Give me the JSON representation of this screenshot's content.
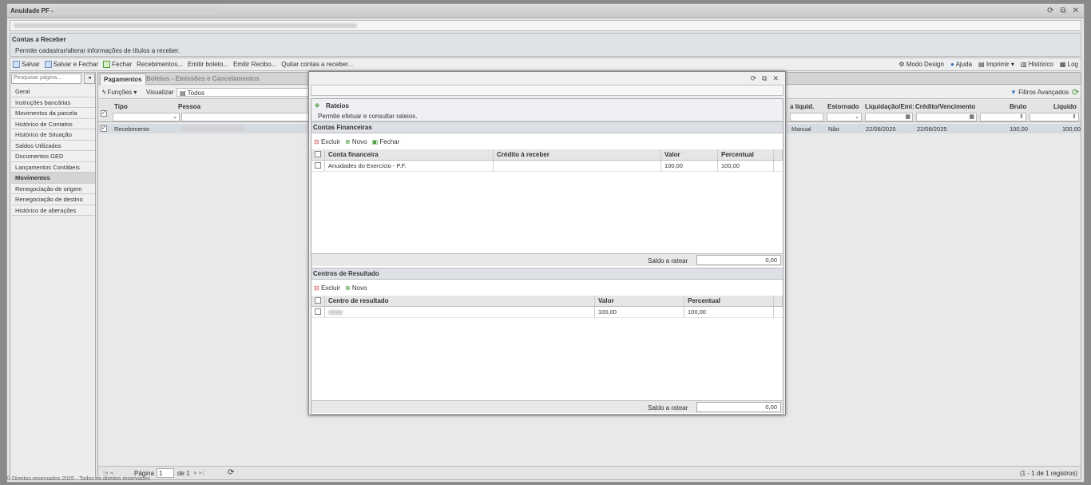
{
  "window": {
    "title": "Anuidade PF -"
  },
  "header": {
    "title": "Contas a Receber",
    "subtitle": "Permite cadastrar/alterar informações de títulos a receber."
  },
  "toolbar": {
    "salvar": "Salvar",
    "salvar_fechar": "Salvar e Fechar",
    "fechar": "Fechar",
    "recebimentos": "Recebimentos...",
    "emitir_boleto": "Emitir boleto...",
    "emitir_recibo": "Emitir Recibo...",
    "quitar": "Quitar contas a receber...",
    "modo_design": "Modo Design",
    "ajuda": "Ajuda",
    "imprimir": "Imprimir",
    "historico": "Histórico",
    "log": "Log"
  },
  "sidebar": {
    "search_placeholder": "Pesquisar página...",
    "items": [
      "Geral",
      "Instruções bancárias",
      "Movimentos da parcela",
      "Histórico de Contatos",
      "Histórico de Situação",
      "Saldos Utilizados",
      "Documentos GED",
      "Lançamentos Contábeis",
      "Movimentos",
      "Renegociação de origem",
      "Renegociação de destino",
      "Histórico de alterações"
    ],
    "selected": "Movimentos"
  },
  "tabs": {
    "pagamentos": "Pagamentos",
    "boletos": "Boletos - Emissões e Cancelamentos"
  },
  "grid_toolbar": {
    "funcoes": "Funções",
    "visualizar": "Visualizar",
    "todos": "Todos",
    "filtros": "Filtros Avançados"
  },
  "grid": {
    "columns": {
      "tipo": "Tipo",
      "pessoa": "Pessoa",
      "liquid": "a liquid.",
      "estornado": "Estornado",
      "liquidacao": "Liquidação/Emi:",
      "credito": "Crédito/Vencimento",
      "bruto": "Bruto",
      "liquido": "Líquido"
    },
    "row": {
      "tipo": "Recebimento",
      "liquid": "Manual",
      "estornado": "Não",
      "liquidacao": "22/08/2025",
      "credito": "22/08/2025",
      "bruto": "100,00",
      "liquido": "100,00"
    }
  },
  "pager": {
    "pagina": "Página",
    "value": "1",
    "de": "de 1",
    "registros": "(1 - 1 de 1 registros)"
  },
  "footer": "© Direitos reservados 2025 · Todos os direitos reservados",
  "dialog": {
    "title": "Rateios",
    "subtitle": "Permite efetuar e consultar rateios.",
    "contas": {
      "heading": "Contas Financeiras",
      "excluir": "Excluir",
      "novo": "Novo",
      "fechar": "Fechar",
      "cols": [
        "Conta financeira",
        "Crédito à receber",
        "Valor",
        "Percentual"
      ],
      "row": [
        "Anuidades do Exercício - P.F.",
        "",
        "100,00",
        "100,00"
      ],
      "saldo_label": "Saldo a ratear",
      "saldo": "0,00"
    },
    "centros": {
      "heading": "Centros de Resultado",
      "excluir": "Excluir",
      "novo": "Novo",
      "cols": [
        "Centro de resultado",
        "Valor",
        "Percentual"
      ],
      "row": [
        "",
        "100,00",
        "100,00"
      ],
      "saldo_label": "Saldo a ratear",
      "saldo": "0,00"
    }
  }
}
